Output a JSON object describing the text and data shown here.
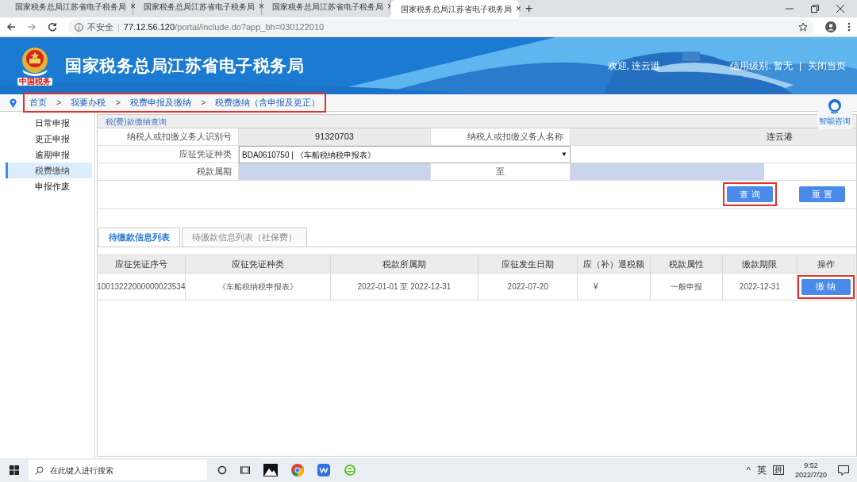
{
  "browser": {
    "tabs": [
      {
        "title": "国家税务总局江苏省电子税务局",
        "selected": false
      },
      {
        "title": "国家税务总局江苏省电子税务局",
        "selected": false
      },
      {
        "title": "国家税务总局江苏省电子税务局",
        "selected": false
      },
      {
        "title": "国家税务总局江苏省电子税务局",
        "selected": true
      }
    ],
    "tab_close": "×",
    "new_tab": "+",
    "security": "不安全",
    "url_divider": "|",
    "url_host": "77.12.56.120",
    "url_path": "/portal/include.do?app_bh=030122010"
  },
  "banner": {
    "logo_caption": "中国税务",
    "title": "国家税务总局江苏省电子税务局",
    "welcome": "欢迎, 连云港",
    "credit": "信用级别: 暂无",
    "separator": "|",
    "close": "关闭当页"
  },
  "breadcrumb": {
    "highlighted": true,
    "separator": ">",
    "items": [
      "首页",
      "我要办税",
      "税费申报及缴纳",
      "税费缴纳（含申报及更正）"
    ]
  },
  "help": {
    "label": "智能咨询"
  },
  "sidebar": {
    "items": [
      {
        "label": "日常申报",
        "selected": false
      },
      {
        "label": "更正申报",
        "selected": false
      },
      {
        "label": "逾期申报",
        "selected": false
      },
      {
        "label": "税费缴纳",
        "selected": true
      },
      {
        "label": "申报作废",
        "selected": false
      }
    ]
  },
  "form": {
    "title": "税(费)款缴纳查询",
    "taxpayer_id_label": "纳税人或扣缴义务人识别号",
    "taxpayer_id": "91320703",
    "taxpayer_name_label": "纳税人或扣缴义务人名称",
    "taxpayer_name": "连云港",
    "voucher_type_label": "应征凭证种类",
    "voucher_type": "BDA0610750 | 《车船税纳税申报表》",
    "dropdown_caret": "▼",
    "period_label": "税款属期",
    "period_to": "至"
  },
  "buttons": [
    {
      "label": "查 询",
      "highlighted": true
    },
    {
      "label": "重 置",
      "highlighted": false
    }
  ],
  "list_tabs": [
    {
      "label": "待缴款信息列表",
      "selected": true
    },
    {
      "label": "待缴款信息列表（社保费）",
      "selected": false
    }
  ],
  "table": {
    "columns": [
      "应征凭证序号",
      "应征凭证种类",
      "税款所属期",
      "应征发生日期",
      "应（补）退税额",
      "税款属性",
      "缴款期限",
      "操作"
    ],
    "rows": [
      {
        "cells": [
          "10013222000000023534",
          "《车船税纳税申报表》",
          "2022-01-01 至 2022-12-31",
          "2022-07-20",
          "¥",
          "一般申报",
          "2022-12-31"
        ],
        "action": {
          "label": "缴 纳",
          "highlighted": true
        }
      }
    ]
  },
  "taskbar": {
    "search_placeholder": "在此键入进行搜索",
    "tray_caret": "^",
    "ime": "英",
    "ime_mode": "拼",
    "time": "9:52",
    "date": "2022/7/20"
  }
}
